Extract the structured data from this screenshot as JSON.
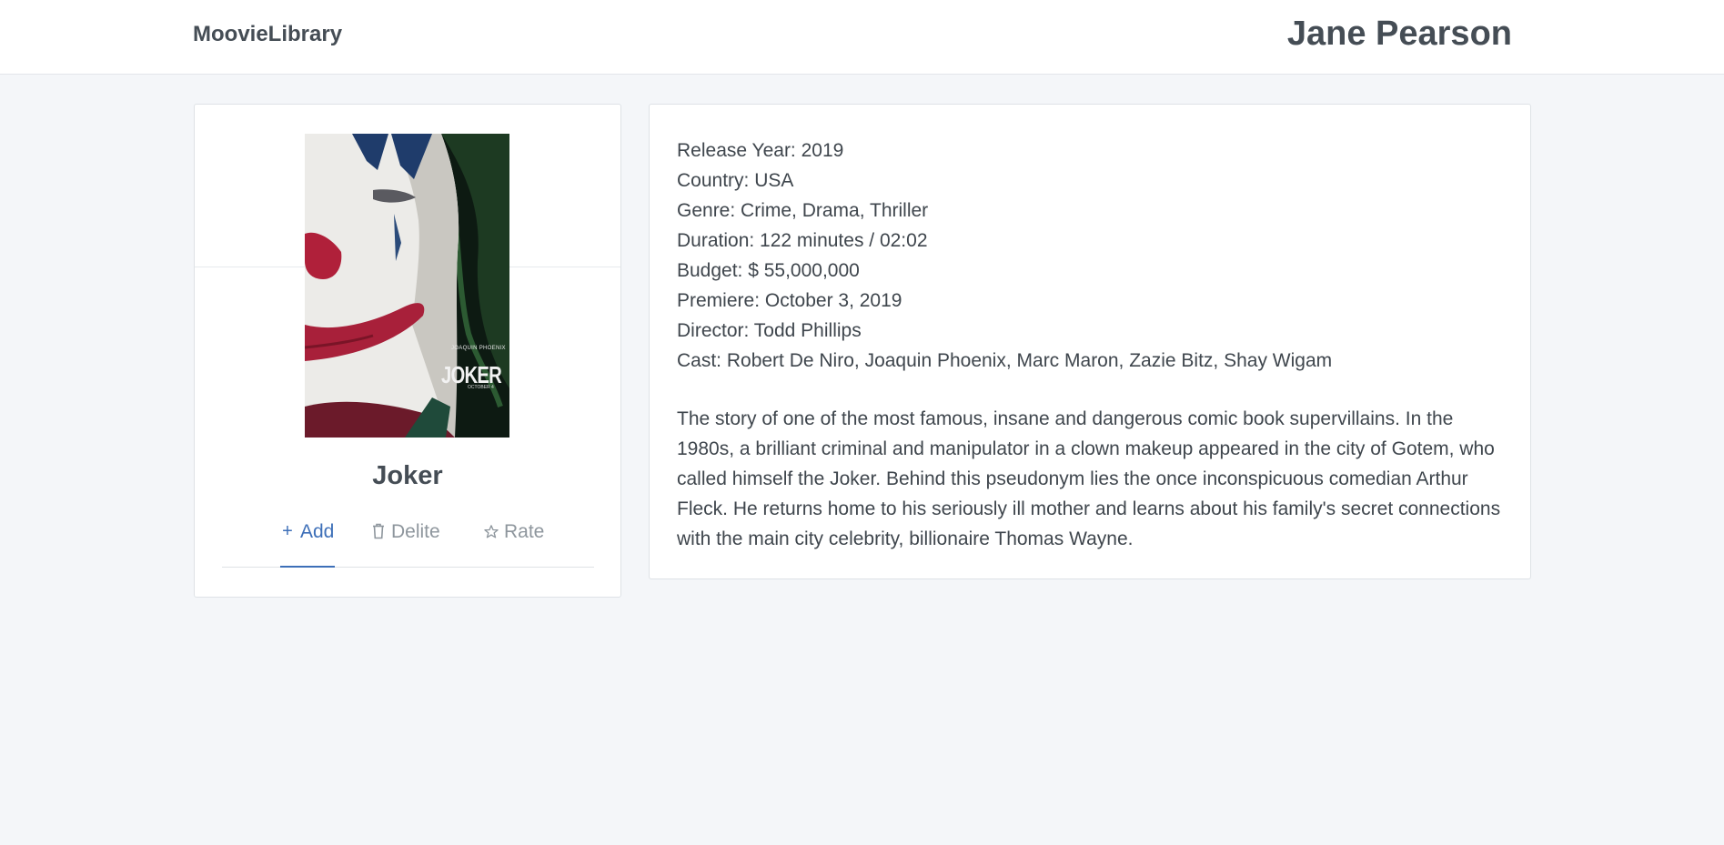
{
  "header": {
    "brand": "MoovieLibrary",
    "user_name": "Jane Pearson"
  },
  "movie": {
    "title": "Joker",
    "poster": {
      "top_text": "JOAQUIN PHOENIX",
      "logo_text": "JOKER",
      "date_text": "OCTOBER 4"
    },
    "actions": [
      {
        "label": "Add",
        "icon": "plus-icon",
        "active": true
      },
      {
        "label": "Delite",
        "icon": "trash-icon",
        "active": false
      },
      {
        "label": "Rate",
        "icon": "star-icon",
        "active": false
      }
    ],
    "facts": {
      "release_year": "Release Year: 2019",
      "country": "Country: USA",
      "genre": "Genre: Crime, Drama, Thriller",
      "duration": "Duration: 122 minutes / 02:02",
      "budget": "Budget: $ 55,000,000",
      "premiere": "Premiere: October 3, 2019",
      "director": "Director: Todd Phillips",
      "cast": "Cast: Robert De Niro, Joaquin Phoenix, Marc Maron, Zazie Bitz, Shay Wigam"
    },
    "description": "The story of one of the most famous, insane and dangerous comic book supervillains. In the 1980s, a brilliant criminal and manipulator in a clown makeup appeared in the city of Gotem, who called himself the Joker. Behind this pseudonym lies the once inconspicuous comedian Arthur Fleck. He returns home to his seriously ill mother and learns about his family's secret connections with the main city celebrity, billionaire Thomas Wayne."
  },
  "colors": {
    "accent": "#3d6fb8",
    "background": "#f4f6f9",
    "text": "#3f464d"
  }
}
